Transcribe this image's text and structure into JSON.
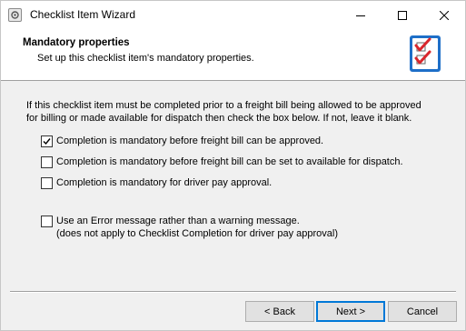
{
  "window": {
    "title": "Checklist Item Wizard"
  },
  "header": {
    "title": "Mandatory properties",
    "subtitle": "Set up this checklist item's mandatory properties."
  },
  "intro": {
    "line1": "If this checklist item must be completed prior to a freight bill being allowed to be approved",
    "line2": "for billing or made available for dispatch then check the box below. If not, leave it blank."
  },
  "options": [
    {
      "label": "Completion is mandatory before freight bill can be approved.",
      "checked": true
    },
    {
      "label": "Completion is mandatory before freight bill can be set to available for dispatch.",
      "checked": false
    },
    {
      "label": "Completion is mandatory for driver pay approval.",
      "checked": false
    },
    {
      "label": "Use an Error message rather than a warning message.",
      "sublabel": "(does not apply to Checklist Completion for driver pay approval)",
      "checked": false
    }
  ],
  "buttons": {
    "back": "< Back",
    "next": "Next >",
    "cancel": "Cancel"
  },
  "icons": {
    "app": "app-icon",
    "header": "checklist-icon",
    "minimize": "minimize-icon",
    "maximize": "maximize-icon",
    "close": "close-icon",
    "check": "checkmark-icon"
  },
  "colors": {
    "accent": "#0078d7",
    "checklist_red": "#d9262c",
    "checklist_blue": "#1e6fc8"
  }
}
